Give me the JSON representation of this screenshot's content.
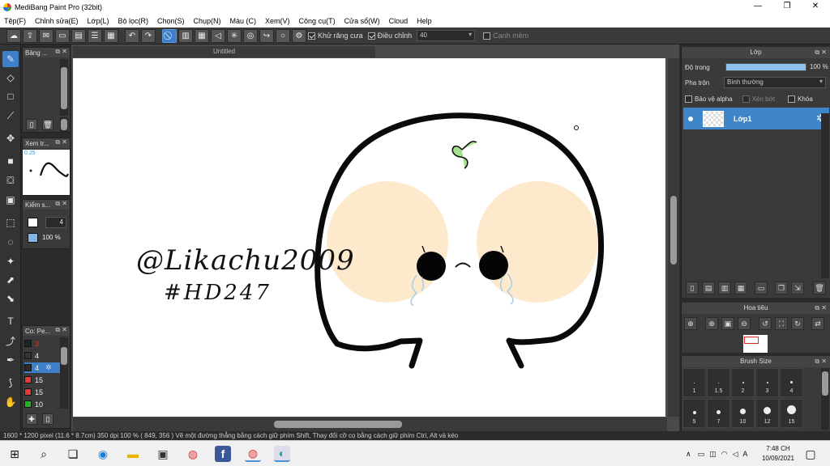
{
  "window": {
    "title": "MediBang Paint Pro (32bit)",
    "controls": [
      "—",
      "❐",
      "✕"
    ]
  },
  "menu": [
    "Tệp(F)",
    "Chỉnh sửa(E)",
    "Lớp(L)",
    "Bộ lọc(R)",
    "Chọn(S)",
    "Chụp(N)",
    "Màu (C)",
    "Xem(V)",
    "Công cụ(T)",
    "Cửa sổ(W)",
    "Cloud",
    "Help"
  ],
  "toolbar": {
    "antialias_label": "Khử răng cưa",
    "adjust_label": "Điều chỉnh",
    "adjust_value": "40",
    "edge_label": "Cạnh mềm"
  },
  "left_panels": {
    "brush_title": "Bảng ...",
    "navigator_title": "Xem tr...",
    "navigator_zoom": "0.25",
    "brushsize_title": "Kiểm s...",
    "brush_size_value": "4",
    "brush_opacity_value": "100 %",
    "palette_title": "Co: Pe...",
    "palette": [
      {
        "num": "3",
        "color": "#222222"
      },
      {
        "num": "4",
        "color": "#333333"
      },
      {
        "num": "4",
        "color": "#2a2a2a"
      },
      {
        "num": "15",
        "color": "#e03a3a"
      },
      {
        "num": "15",
        "color": "#e03a3a"
      },
      {
        "num": "10",
        "color": "#22b522"
      }
    ]
  },
  "canvas": {
    "doc_title": "Untitled",
    "signature_line1": "@Likachu2009",
    "signature_line2": "#HD247"
  },
  "status": {
    "text": "1600 * 1200 pixel  (11.6 * 8.7cm)  350 dpi  100 %  ( 849, 356 )  Vẽ một đường thẳng bằng cách giữ phím Shift, Thay đổi cỡ cọ bằng cách giữ phím Ctrl, Alt và kéo"
  },
  "layer_panel": {
    "title": "Lớp",
    "opacity_label": "Độ trong",
    "opacity_value": "100 %",
    "opacity_fraction": 1.0,
    "blend_label": "Pha trộn",
    "blend_value": "Bình thường",
    "protect_alpha_label": "Bảo vệ alpha",
    "clip_label": "Xén bớt",
    "lock_label": "Khóa",
    "layer_name": "Lớp1"
  },
  "navigator_panel": {
    "title": "Hoa tiêu"
  },
  "brush_size_panel": {
    "title": "Brush Size",
    "sizes_row1": [
      "1",
      "1.5",
      "2",
      "3",
      "4"
    ],
    "sizes_row2": [
      "5",
      "7",
      "10",
      "12",
      "15"
    ]
  },
  "taskbar": {
    "time": "7:48 CH",
    "date": "10/09/2021"
  },
  "colors": {
    "accent": "#3e7fc9",
    "cheek": "#fde9cc",
    "sprout": "#a6e08c"
  }
}
